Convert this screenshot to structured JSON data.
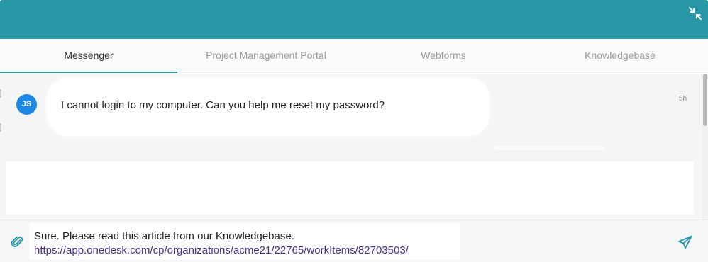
{
  "header": {
    "collapse_icon": "collapse-arrows-icon",
    "background_color": "#2796a5"
  },
  "tabs": [
    {
      "label": "Messenger",
      "active": true
    },
    {
      "label": "Project Management Portal",
      "active": false
    },
    {
      "label": "Webforms",
      "active": false
    },
    {
      "label": "Knowledgebase",
      "active": false
    }
  ],
  "conversation": {
    "messages": [
      {
        "avatar_initials": "JS",
        "text": "I cannot login to my computer. Can you help me reset my password?",
        "time": "5h"
      }
    ]
  },
  "composer": {
    "attach_icon": "paperclip-icon",
    "send_icon": "paper-plane-icon",
    "draft_line1": "Sure. Please read this article from our Knowledgebase.",
    "draft_link": "https://app.onedesk.com/cp/organizations/acme21/22765/workItems/82703503/"
  },
  "colors": {
    "accent": "#2796a5",
    "avatar": "#1e88e5",
    "link": "#4a2e8a"
  }
}
